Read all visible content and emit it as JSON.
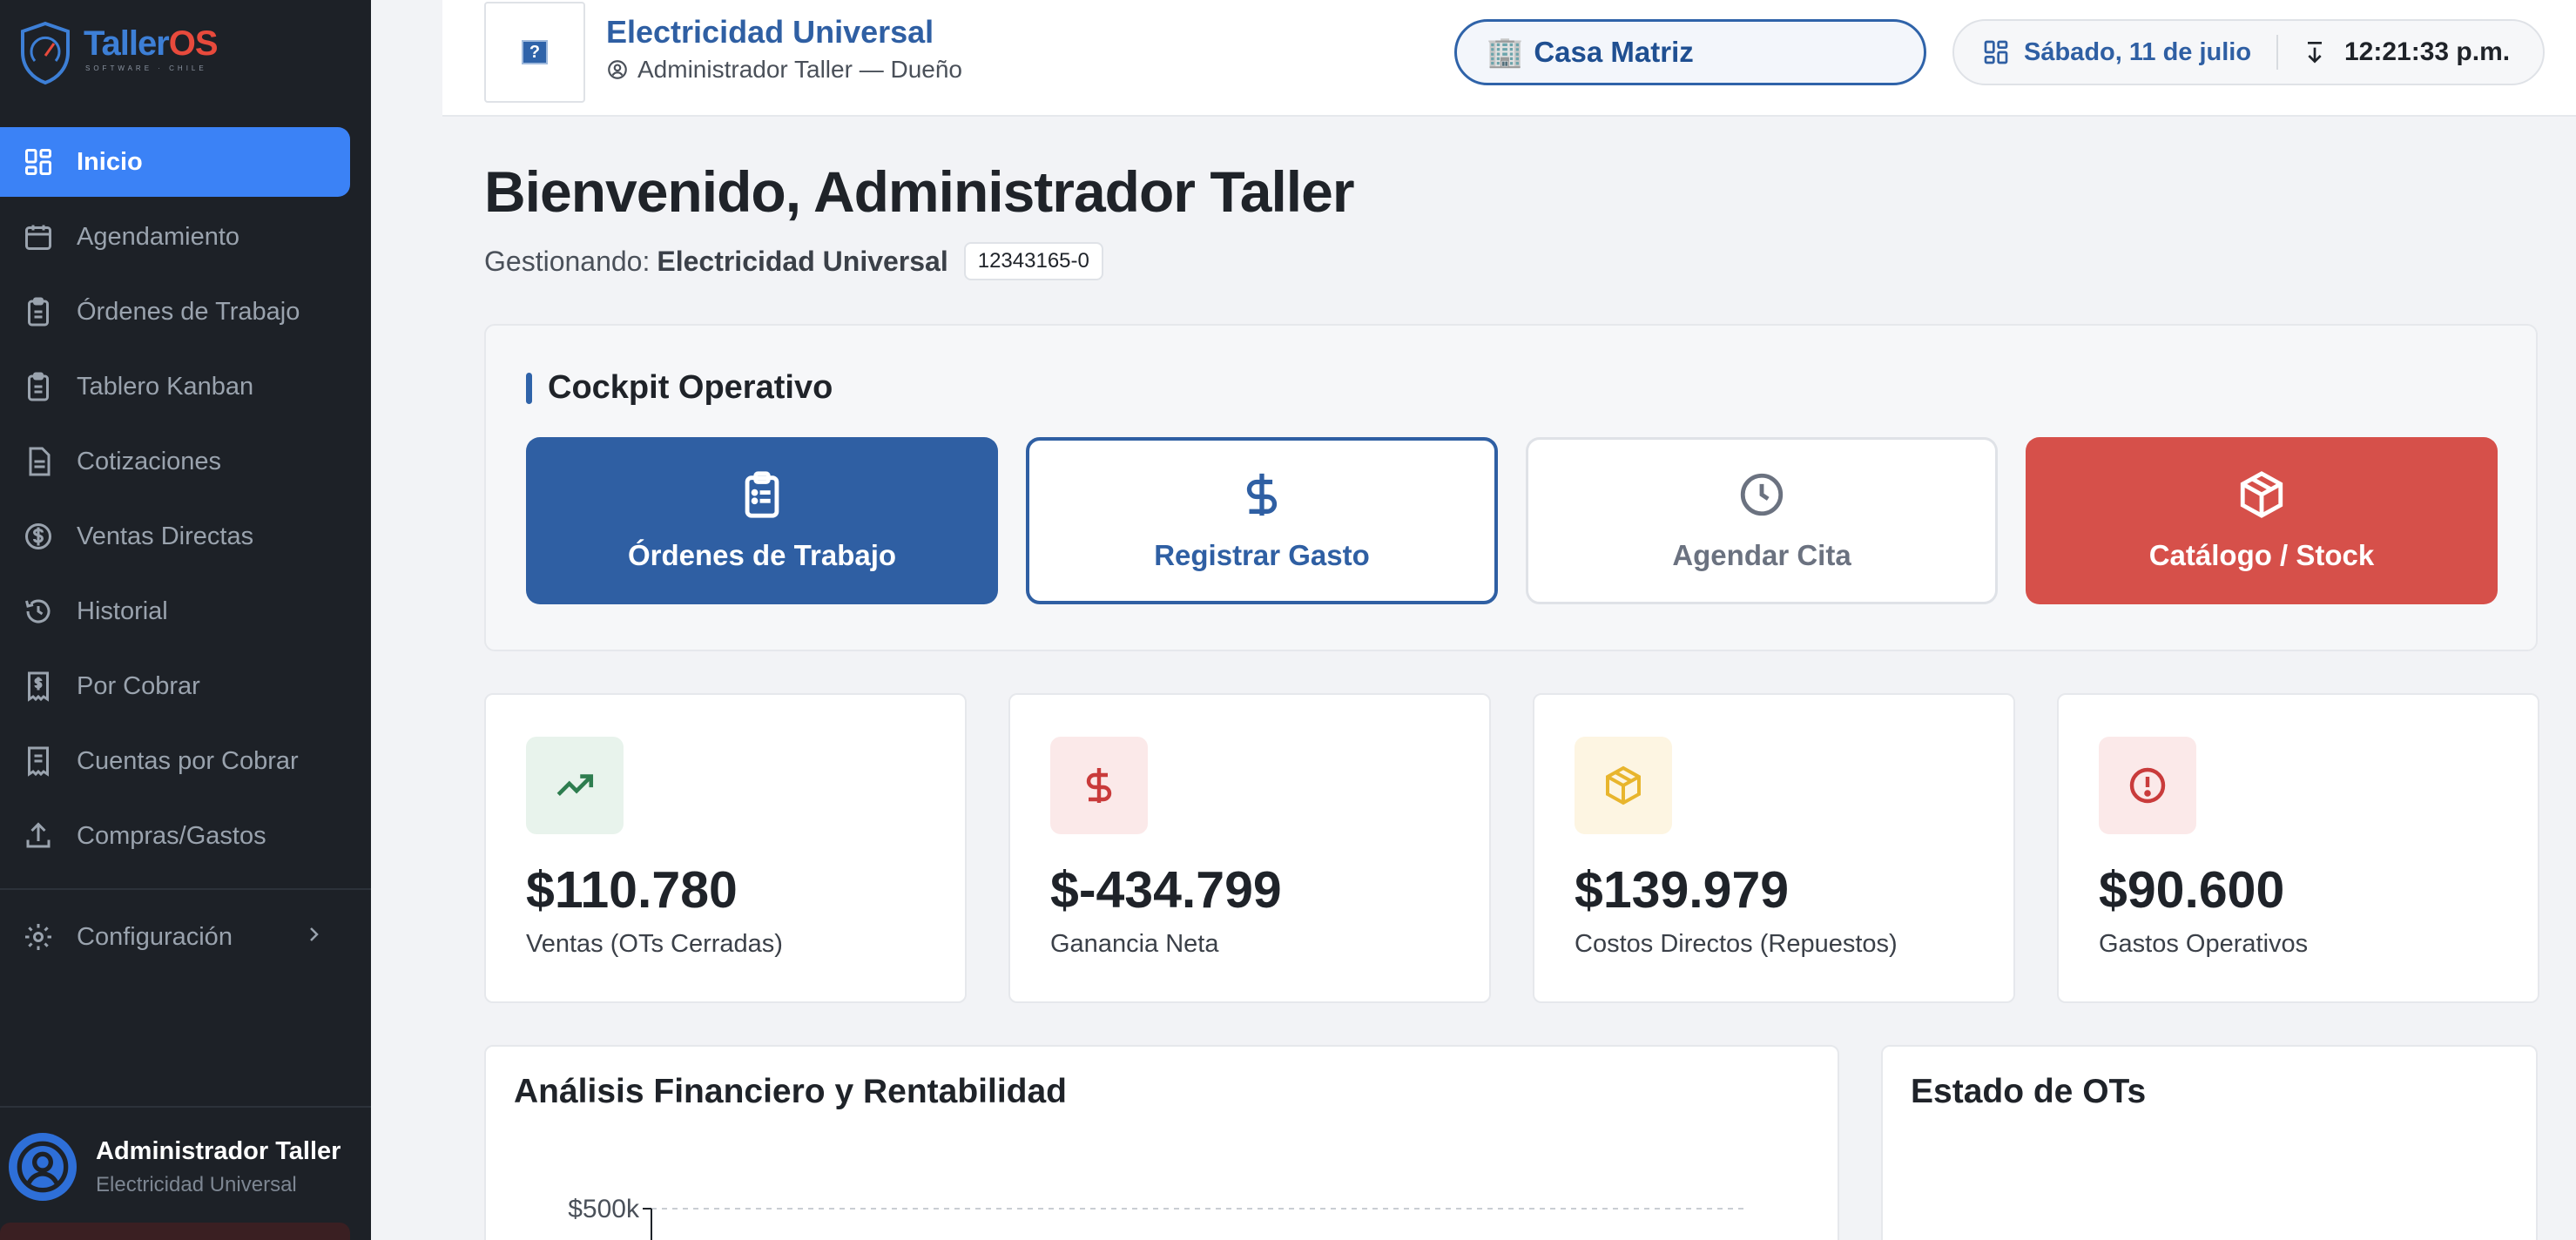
{
  "brand": {
    "name_main": "Taller",
    "name_os": "OS",
    "tagline": "SOFTWARE · CHILE"
  },
  "sidebar": {
    "items": [
      {
        "label": "Inicio",
        "icon": "dashboard-icon",
        "active": true
      },
      {
        "label": "Agendamiento",
        "icon": "calendar-icon"
      },
      {
        "label": "Órdenes de Trabajo",
        "icon": "clipboard-icon"
      },
      {
        "label": "Tablero Kanban",
        "icon": "clipboard-icon"
      },
      {
        "label": "Cotizaciones",
        "icon": "document-icon"
      },
      {
        "label": "Ventas Directas",
        "icon": "dollar-circle-icon"
      },
      {
        "label": "Historial",
        "icon": "history-icon"
      },
      {
        "label": "Por Cobrar",
        "icon": "receipt-dollar-icon"
      },
      {
        "label": "Cuentas por Cobrar",
        "icon": "receipt-icon"
      },
      {
        "label": "Compras/Gastos",
        "icon": "upload-icon"
      }
    ],
    "settings_label": "Configuración",
    "user": {
      "name": "Administrador Taller",
      "org": "Electricidad Universal"
    }
  },
  "header": {
    "business_name": "Electricidad Universal",
    "role": "Administrador Taller — Dueño",
    "branch": "Casa Matriz",
    "date": "Sábado, 11 de julio",
    "time": "12:21:33 p.m."
  },
  "welcome": {
    "title": "Bienvenido, Administrador Taller",
    "managing_prefix": "Gestionando:",
    "managing_name": "Electricidad Universal",
    "rut": "12343165-0"
  },
  "cockpit": {
    "title": "Cockpit Operativo",
    "buttons": [
      {
        "label": "Órdenes de Trabajo",
        "icon": "clipboard-icon"
      },
      {
        "label": "Registrar Gasto",
        "icon": "dollar-icon"
      },
      {
        "label": "Agendar Cita",
        "icon": "clock-icon"
      },
      {
        "label": "Catálogo / Stock",
        "icon": "box-icon"
      }
    ]
  },
  "stats": [
    {
      "value": "$110.780",
      "label": "Ventas (OTs Cerradas)",
      "icon": "trending-up-icon",
      "color": "#2e7d4f",
      "bg": "#e8f3ec"
    },
    {
      "value": "$-434.799",
      "label": "Ganancia Neta",
      "icon": "dollar-icon",
      "color": "#c93b3b",
      "bg": "#fbe9e9"
    },
    {
      "value": "$139.979",
      "label": "Costos Directos (Repuestos)",
      "icon": "box-icon",
      "color": "#e8b52d",
      "bg": "#fdf5e2"
    },
    {
      "value": "$90.600",
      "label": "Gastos Operativos",
      "icon": "alert-circle-icon",
      "color": "#c93b3b",
      "bg": "#fbe9e9"
    }
  ],
  "cards": {
    "financial_title": "Análisis Financiero y Rentabilidad",
    "ot_status_title": "Estado de OTs"
  },
  "chart_data": {
    "type": "bar",
    "title": "Análisis Financiero y Rentabilidad",
    "y_ticks": [
      "$500k"
    ],
    "series": []
  }
}
